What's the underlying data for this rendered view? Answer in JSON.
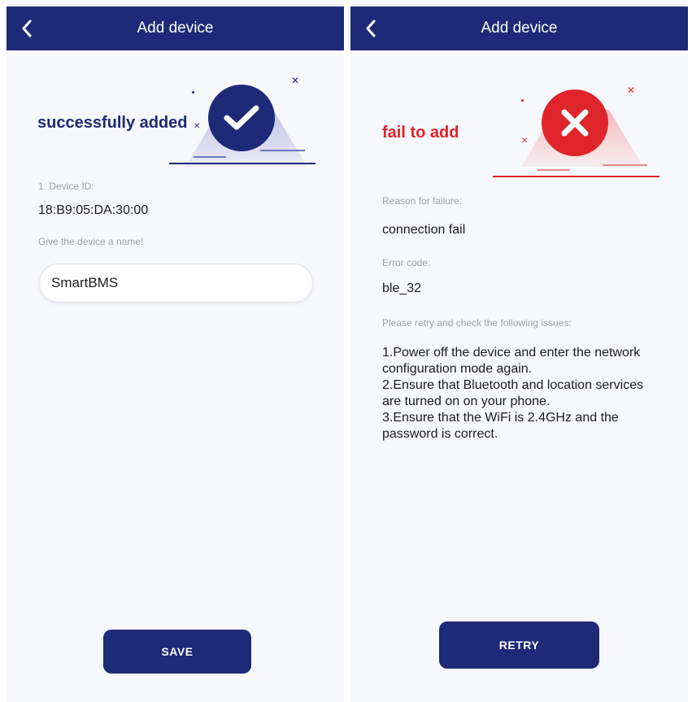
{
  "left_screen": {
    "header": {
      "title": "Add device",
      "back_icon": "chevron-left-icon"
    },
    "status": {
      "text": "successfully added",
      "icon": "checkmark-icon",
      "color": "#1d2a78"
    },
    "device_id": {
      "label": "1. Device ID:",
      "value": "18:B9:05:DA:30:00"
    },
    "device_name": {
      "label": "Give the device a name!",
      "value": "SmartBMS"
    },
    "save_button": {
      "label": "SAVE"
    }
  },
  "right_screen": {
    "header": {
      "title": "Add device",
      "back_icon": "chevron-left-icon"
    },
    "status": {
      "text": "fail to add",
      "icon": "close-x-icon",
      "color": "#e0242b"
    },
    "reason": {
      "label": "Reason for failure:",
      "value": "connection fail"
    },
    "error_code": {
      "label": "Error code:",
      "value": "ble_32"
    },
    "instructions": {
      "label": "Please retry and check the following issues:",
      "items": [
        "1.Power off the device and enter the network configuration mode again.",
        "2.Ensure that Bluetooth and location services are turned on on your phone.",
        "3.Ensure that the WiFi is 2.4GHz and the password is correct."
      ]
    },
    "retry_button": {
      "label": "RETRY"
    }
  },
  "colors": {
    "header_bg": "#1d2a78",
    "success": "#1d2a78",
    "error": "#e0242b"
  }
}
